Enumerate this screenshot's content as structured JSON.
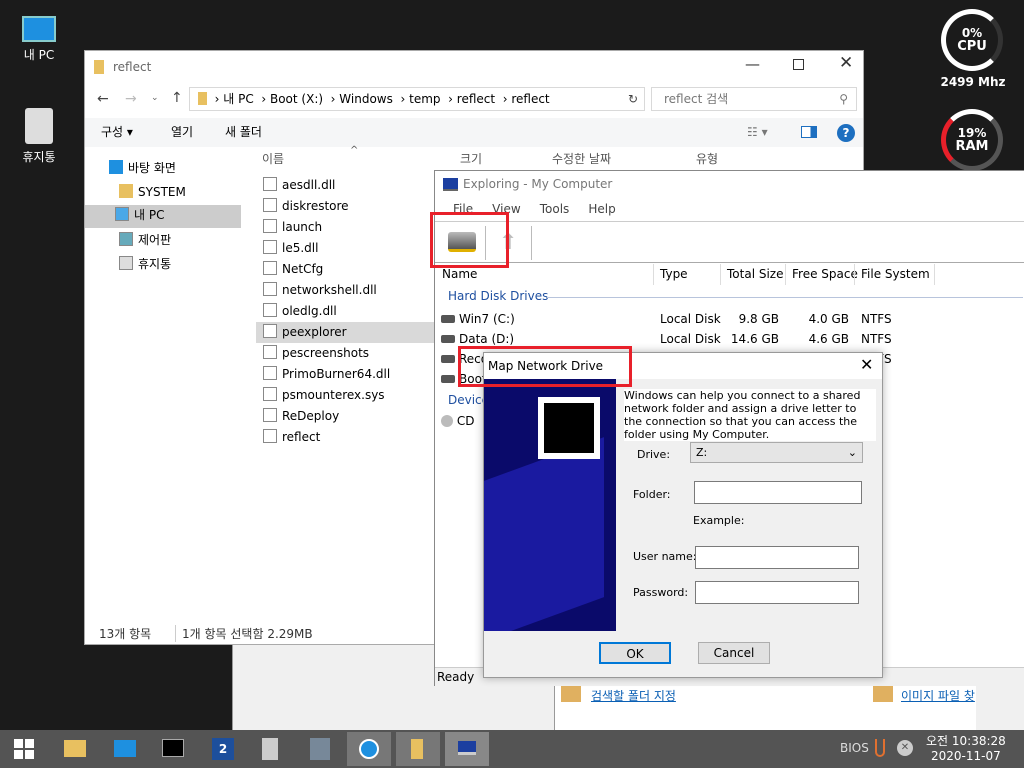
{
  "desktop": {
    "icons": [
      {
        "label": "내 PC"
      },
      {
        "label": "휴지통"
      }
    ]
  },
  "gauges": {
    "cpu": {
      "percent": "0%",
      "label": "CPU",
      "freq": "2499 Mhz"
    },
    "ram": {
      "percent": "19%",
      "label": "RAM"
    }
  },
  "explorer": {
    "title": "reflect",
    "breadcrumb": [
      "내 PC",
      "Boot (X:)",
      "Windows",
      "temp",
      "reflect",
      "reflect"
    ],
    "search_placeholder": "reflect 검색",
    "commands": {
      "organize": "구성 ▾",
      "open": "열기",
      "new_folder": "새 폴더"
    },
    "columns": [
      "이름",
      "크기",
      "수정한 날짜",
      "유형"
    ],
    "nav": [
      "바탕 화면",
      "SYSTEM",
      "내 PC",
      "제어판",
      "휴지통"
    ],
    "files": [
      "aesdll.dll",
      "diskrestore",
      "launch",
      "le5.dll",
      "NetCfg",
      "networkshell.dll",
      "oledlg.dll",
      "peexplorer",
      "pescreenshots",
      "PrimoBurner64.dll",
      "psmounterex.sys",
      "ReDeploy",
      "reflect"
    ],
    "selected": "peexplorer",
    "status": {
      "count": "13개 항목",
      "selection": "1개 항목 선택함 2.29MB"
    }
  },
  "pe": {
    "title": "Exploring - My Computer",
    "menu": [
      "File",
      "View",
      "Tools",
      "Help"
    ],
    "columns": [
      "Name",
      "Type",
      "Total Size",
      "Free Space",
      "File System"
    ],
    "group_hdd": "Hard Disk Drives",
    "group_dev": "Devices",
    "drives": [
      {
        "name": "Win7 (C:)",
        "type": "Local Disk",
        "total": "9.8 GB",
        "free": "4.0 GB",
        "fs": "NTFS"
      },
      {
        "name": "Data (D:)",
        "type": "Local Disk",
        "total": "14.6 GB",
        "free": "4.6 GB",
        "fs": "NTFS"
      },
      {
        "name": "Reco",
        "type": "",
        "total": "",
        "free": "",
        "fs": "NTFS"
      },
      {
        "name": "Boot",
        "type": "",
        "total": "",
        "free": "",
        "fs": "S"
      }
    ],
    "cd": "CD",
    "status": "Ready"
  },
  "dialog": {
    "title": "Map Network Drive",
    "intro": "Windows can help you connect to a shared network folder and assign a drive letter to the connection so that you can access the folder using My Computer.",
    "drive_label": "Drive:",
    "drive_value": "Z:",
    "folder_label": "Folder:",
    "folder_value": "",
    "example_label": "Example:",
    "user_label": "User name:",
    "user_value": "",
    "pass_label": "Password:",
    "pass_value": "",
    "ok": "OK",
    "cancel": "Cancel"
  },
  "back_panel": {
    "link1": "검색할 폴더 지정",
    "link2": "이미지 파일 찾"
  },
  "taskbar": {
    "tray_text": "BIOS",
    "time": "오전 10:38:28",
    "date": "2020-11-07"
  },
  "colors": {
    "highlight": "#e8202a",
    "accent": "#0078d7",
    "dialog_art": "#0a0a6a"
  }
}
